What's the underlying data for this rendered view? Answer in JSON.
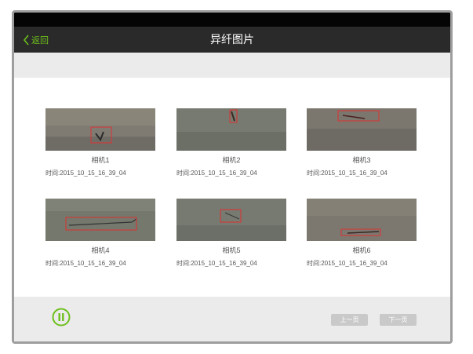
{
  "header": {
    "back_label": "返回",
    "title": "异纤图片"
  },
  "cameras": [
    {
      "label": "相机1",
      "time": "时间:2015_10_15_16_39_04"
    },
    {
      "label": "相机2",
      "time": "时间:2015_10_15_16_39_04"
    },
    {
      "label": "相机3",
      "time": "时间:2015_10_15_16_39_04"
    },
    {
      "label": "相机4",
      "time": "时间:2015_10_15_16_39_04"
    },
    {
      "label": "相机5",
      "time": "时间:2015_10_15_16_39_04"
    },
    {
      "label": "相机6",
      "time": "时间:2015_10_15_16_39_04"
    }
  ],
  "footer": {
    "prev_label": "上一页",
    "next_label": "下一页"
  },
  "icons": {
    "back": "chevron-left-icon",
    "pause": "pause-icon"
  },
  "colors": {
    "accent": "#6dbf1c",
    "titlebar": "#2a2a2a",
    "highlight_box": "#e03030"
  }
}
